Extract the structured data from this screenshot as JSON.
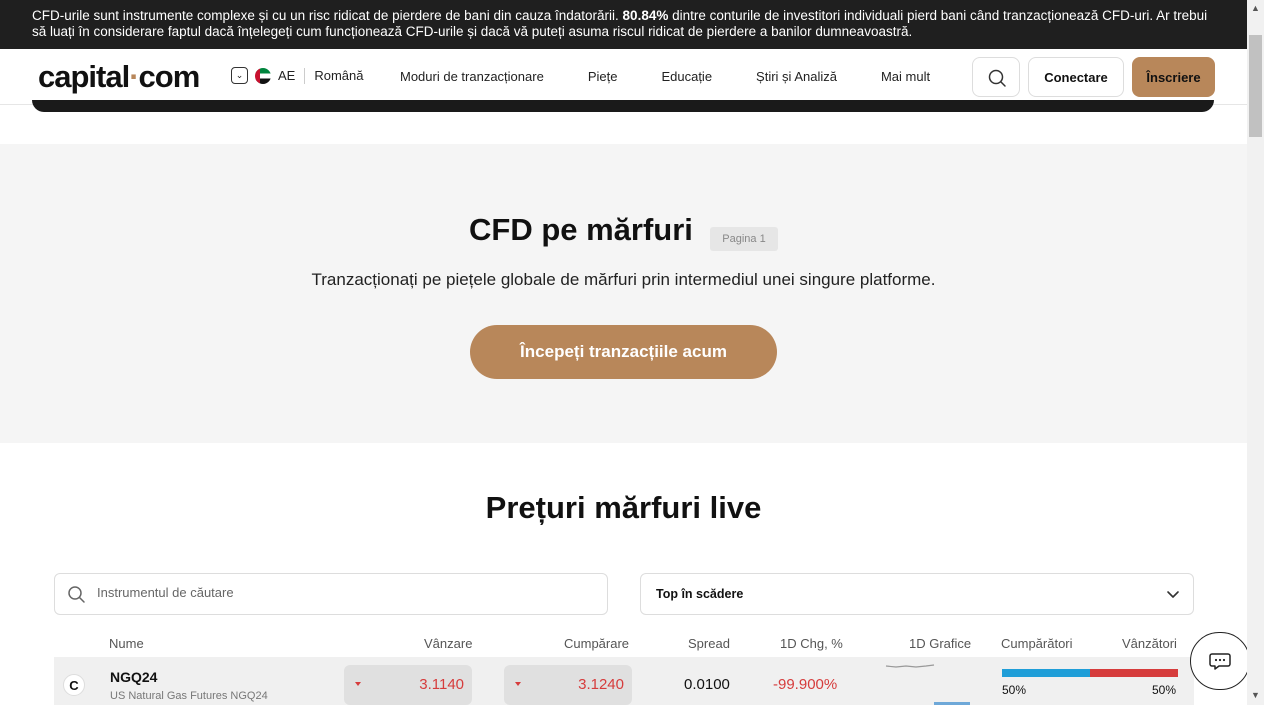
{
  "banner": {
    "text_before": "CFD-urile sunt instrumente complexe și cu un risc ridicat de pierdere de bani din cauza îndatorării.",
    "percent": "80.84%",
    "text_after": "dintre conturile de investitori individuali pierd bani când tranzacționează CFD-uri. Ar trebui să luați în considerare faptul dacă înțelegeți cum funcționează CFD-urile și dacă vă puteți asuma riscul ridicat de pierdere a banilor dumneavoastră."
  },
  "header": {
    "logo_main": "capital",
    "logo_dot": "·",
    "logo_tld": "com",
    "region_code": "AE",
    "language": "Română",
    "nav": [
      "Moduri de tranzacționare",
      "Piețe",
      "Educație",
      "Știri și Analiză",
      "Mai mult"
    ],
    "login": "Conectare",
    "signup": "Înscriere"
  },
  "hero": {
    "title": "CFD pe mărfuri",
    "badge": "Pagina 1",
    "subtitle": "Tranzacționați pe piețele globale de mărfuri prin intermediul unei singure platforme.",
    "cta": "Începeți tranzacțiile acum"
  },
  "prices": {
    "title": "Prețuri mărfuri live",
    "search_placeholder": "Instrumentul de căutare",
    "sort_value": "Top în scădere",
    "columns": {
      "name": "Nume",
      "sell": "Vânzare",
      "buy": "Cumpărare",
      "spread": "Spread",
      "change": "1D Chg, %",
      "chart": "1D Grafice",
      "buyers": "Cumpărători",
      "sellers": "Vânzători"
    },
    "rows": [
      {
        "icon_letter": "C",
        "symbol": "NGQ24",
        "name": "US Natural Gas Futures NGQ24",
        "sell": "3.1140",
        "buy": "3.1240",
        "spread": "0.0100",
        "change": "-99.900%",
        "buyers_pct": "50%",
        "sellers_pct": "50%",
        "buyers_fraction": 0.5
      }
    ]
  },
  "colors": {
    "accent": "#b8875a",
    "negative": "#d63c3c",
    "buyers": "#1f9ed8",
    "banner_bg": "#1f1f1f"
  },
  "icons": {
    "search": "search-icon",
    "chevron": "chevron-down-icon",
    "down_arrow": "down-arrow-icon",
    "chat": "chat-icon"
  }
}
